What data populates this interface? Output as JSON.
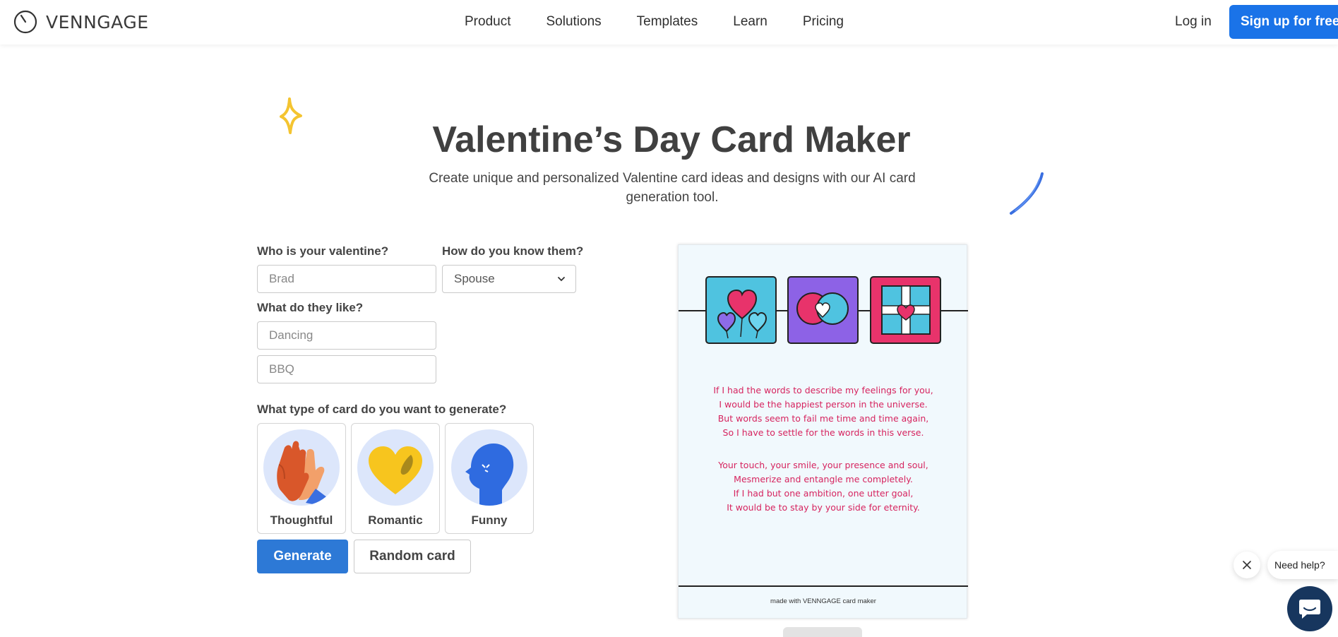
{
  "nav": {
    "brand": "VENNGAGE",
    "links": [
      "Product",
      "Solutions",
      "Templates",
      "Learn",
      "Pricing"
    ],
    "login": "Log in",
    "signup": "Sign up for free"
  },
  "hero": {
    "title": "Valentine’s Day Card Maker",
    "subtitle": "Create unique and personalized Valentine card ideas and designs with our AI card generation tool."
  },
  "form": {
    "who_label": "Who is your valentine?",
    "who_placeholder": "Brad",
    "know_label": "How do you know them?",
    "know_value": "Spouse",
    "like_label": "What do they like?",
    "like1_placeholder": "Dancing",
    "like2_placeholder": "BBQ",
    "type_label": "What type of card do you want to generate?",
    "types": [
      "Thoughtful",
      "Romantic",
      "Funny"
    ],
    "generate": "Generate",
    "random": "Random card"
  },
  "card": {
    "stanza1": [
      "If I had the words to describe my feelings for you,",
      "I would be the happiest person in the universe.",
      "But words seem to fail me time and time again,",
      "So I have to settle for the words in this verse."
    ],
    "stanza2": [
      "Your touch, your smile, your presence and soul,",
      "Mesmerize and entangle me completely.",
      "If I had but one ambition, one utter goal,",
      "It would be to stay by your side for eternity."
    ],
    "footer": "made with VENNGAGE card maker",
    "text_color": "#d6245f",
    "background": "#f1f9fd"
  },
  "help": {
    "text": "Need help?"
  },
  "colors": {
    "primary": "#1a73e8",
    "generate": "#2d79d6",
    "help_button": "#17365e"
  }
}
